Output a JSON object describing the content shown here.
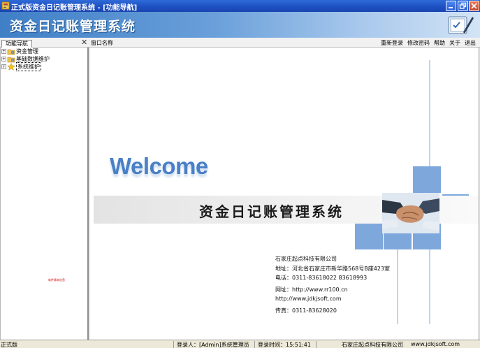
{
  "window": {
    "title": "正式版资金日记账管理系统 - [功能导航]"
  },
  "banner": {
    "app_name": "资金日记账管理系统"
  },
  "toolbar": {
    "nav_tab": "功能导航",
    "close_glyph": "✕",
    "window_name_label": "窗口名称",
    "menu": [
      "重新登录",
      "修改密码",
      "帮助",
      "关于",
      "退出"
    ]
  },
  "tree": {
    "items": [
      {
        "label": "资金管理",
        "icon": "folder-gear-icon"
      },
      {
        "label": "基础数据维护",
        "icon": "folder-gear-icon"
      },
      {
        "label": "系统维护",
        "icon": "star-icon"
      }
    ],
    "small_note": "软件版本信息"
  },
  "welcome": {
    "heading": "Welcome",
    "title": "资金日记账管理系统",
    "company_lines": [
      "石家庄起点科技有限公司",
      "地址：河北省石家庄市新华路568号B座423室",
      "电话：0311-83618022  83618993",
      "网址：http://www.rr100.cn",
      "http://www.jdkjsoft.com",
      "传真：0311-83628020"
    ]
  },
  "statusbar": {
    "edition": "正式版",
    "user": "登录人：[Admin]系统管理员",
    "login_time": "登录时间：15:51:41",
    "company": "石家庄起点科技有限公司",
    "website": "www.jdkjsoft.com"
  },
  "colors": {
    "titlebar": "#1d4fc1",
    "accent_blue": "#4a80c6",
    "tile_blue": "#7ea8dc"
  }
}
